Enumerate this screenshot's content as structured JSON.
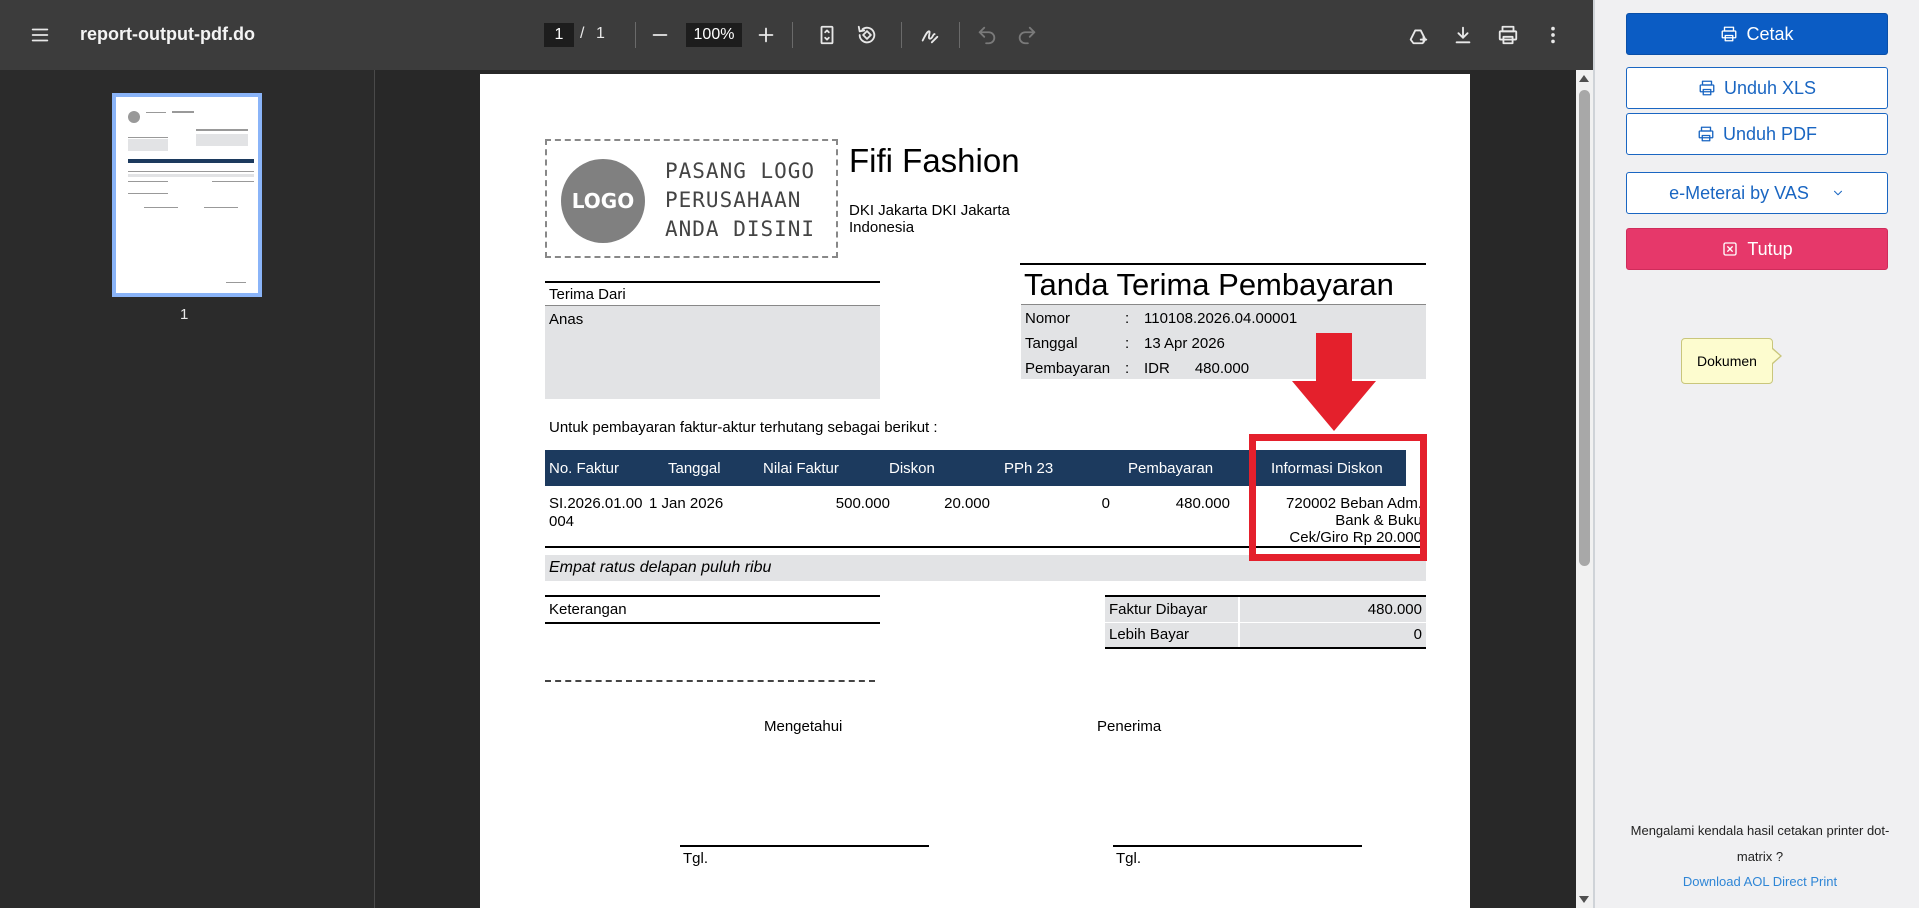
{
  "viewer": {
    "doc_title": "report-output-pdf.do",
    "current_page": "1",
    "page_separator": "/",
    "total_pages": "1",
    "zoom": "100%",
    "thumbnail_label": "1"
  },
  "document": {
    "logo_circle_text": "LOGO",
    "logo_placeholder_lines": [
      "PASANG LOGO",
      "PERUSAHAAN",
      "ANDA DISINI"
    ],
    "company_name": "Fifi Fashion",
    "company_address_line1": "DKI Jakarta DKI Jakarta",
    "company_address_line2": "Indonesia",
    "received_from_label": "Terima Dari",
    "received_from_name": "Anas",
    "heading": "Tanda Terima Pembayaran",
    "info": [
      {
        "label": "Nomor",
        "colon": ":",
        "value": "110108.2026.04.00001"
      },
      {
        "label": "Tanggal",
        "colon": ":",
        "value": "13 Apr 2026"
      },
      {
        "label": "Pembayaran",
        "colon": ":",
        "value": "IDR      480.000"
      }
    ],
    "intro": "Untuk pembayaran faktur-aktur terhutang sebagai berikut :",
    "table": {
      "headers": [
        "No. Faktur",
        "Tanggal",
        "Nilai Faktur",
        "Diskon",
        "PPh 23",
        "Pembayaran",
        "Informasi Diskon"
      ],
      "row": {
        "no_faktur_1": "SI.2026.01.00",
        "no_faktur_2": "004",
        "tanggal": "1 Jan 2026",
        "nilai_faktur": "500.000",
        "diskon": "20.000",
        "pph23": "0",
        "pembayaran": "480.000",
        "info_diskon_1": "720002 Beban Adm.",
        "info_diskon_2": "Bank & Buku",
        "info_diskon_3": "Cek/Giro Rp 20.000"
      }
    },
    "amount_in_words": "Empat ratus delapan puluh ribu",
    "note_label": "Keterangan",
    "summary": [
      {
        "label": "Faktur Dibayar",
        "value": "480.000"
      },
      {
        "label": "Lebih Bayar",
        "value": "0"
      }
    ],
    "sign_left": "Mengetahui",
    "sign_right": "Penerima",
    "date_label": "Tgl."
  },
  "panel": {
    "print_label": "Cetak",
    "download_xls_label": "Unduh XLS",
    "download_pdf_label": "Unduh PDF",
    "emeterai_label": "e-Meterai by VAS",
    "close_label": "Tutup",
    "tooltip": "Dokumen",
    "help_text": "Mengalami kendala hasil cetakan printer dot-matrix ?",
    "help_link": "Download AOL Direct Print"
  },
  "colors": {
    "accent_blue": "#0b5cc4",
    "close_pink": "#e6386a",
    "table_header": "#1c3a5e",
    "annotation_red": "#e4202c"
  }
}
